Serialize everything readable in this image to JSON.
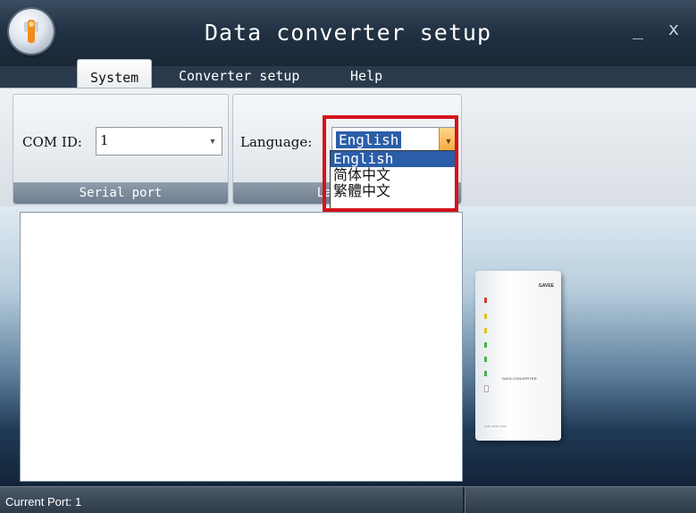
{
  "window": {
    "title": "Data converter setup",
    "minimize": "_",
    "close": "x"
  },
  "tabs": [
    "System",
    "Converter setup",
    "Help"
  ],
  "ribbon": {
    "serial_group": {
      "label": "Serial port",
      "field_label": "COM ID:",
      "value": "1"
    },
    "language_group": {
      "label": "Language",
      "field_label": "Language:",
      "value": "English"
    }
  },
  "language_options": [
    "English",
    "简体中文",
    "繁體中文"
  ],
  "device": {
    "brand": "GAVEE",
    "name": "DATA CONVERTER"
  },
  "status": {
    "text": "Current Port: 1"
  },
  "colors": {
    "highlight": "#d4121b",
    "selection": "#2b5ea8"
  }
}
